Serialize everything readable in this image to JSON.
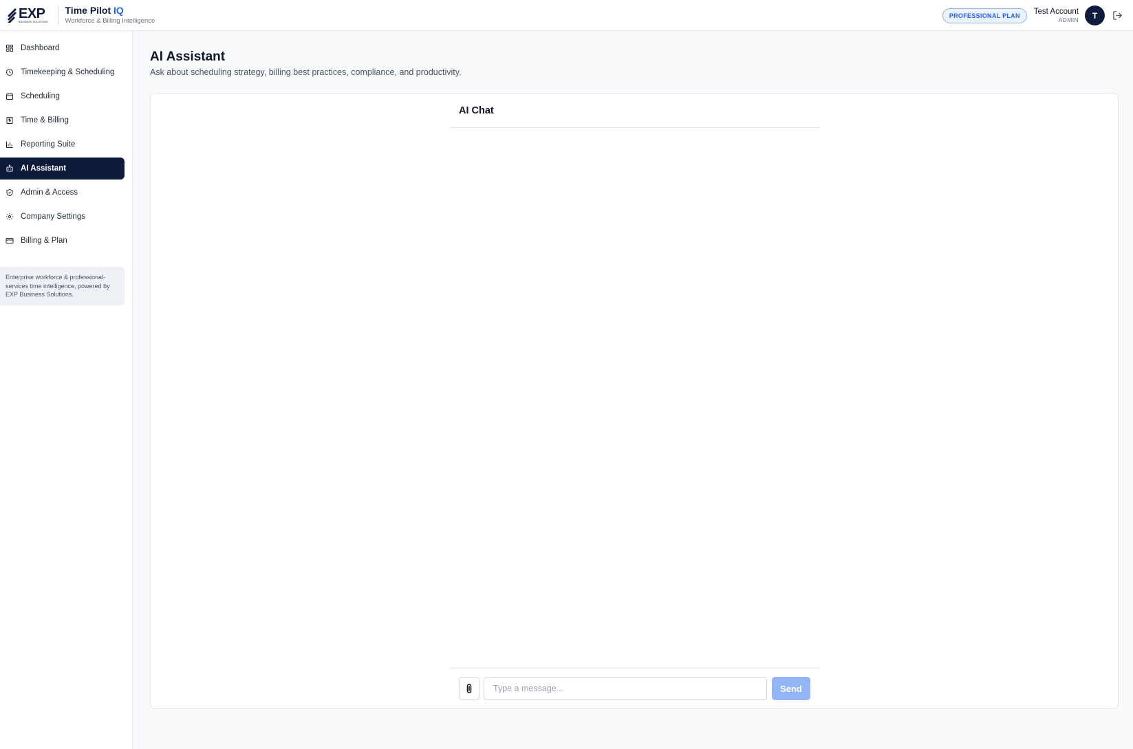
{
  "header": {
    "logo_text": "EXP",
    "logo_subtext": "BUSINESS SOLUTIONS",
    "brand_title": "Time Pilot",
    "brand_title_accent": "IQ",
    "brand_subtitle": "Workforce & Billing Intelligence",
    "plan_badge": "PROFESSIONAL PLAN",
    "account_name": "Test Account",
    "account_role": "ADMIN",
    "avatar_initial": "T",
    "logout_icon": "logout-icon"
  },
  "sidebar": {
    "items": [
      {
        "label": "Dashboard",
        "icon": "grid-icon",
        "active": false
      },
      {
        "label": "Timekeeping & Scheduling",
        "icon": "clock-icon",
        "active": false
      },
      {
        "label": "Scheduling",
        "icon": "calendar-icon",
        "active": false
      },
      {
        "label": "Time & Billing",
        "icon": "receipt-icon",
        "active": false
      },
      {
        "label": "Reporting Suite",
        "icon": "bar-chart-icon",
        "active": false
      },
      {
        "label": "AI Assistant",
        "icon": "bot-icon",
        "active": true
      },
      {
        "label": "Admin & Access",
        "icon": "shield-icon",
        "active": false
      },
      {
        "label": "Company Settings",
        "icon": "gear-icon",
        "active": false
      },
      {
        "label": "Billing & Plan",
        "icon": "credit-card-icon",
        "active": false
      }
    ],
    "note": "Enterprise workforce & professional-services time intelligence, powered by EXP Business Solutions."
  },
  "main": {
    "title": "AI Assistant",
    "subtitle": "Ask about scheduling strategy, billing best practices, compliance, and productivity.",
    "chat": {
      "title": "AI Chat",
      "input_value": "",
      "input_placeholder": "Type a message...",
      "send_label": "Send",
      "attach_icon": "paperclip-icon"
    }
  },
  "colors": {
    "navy": "#0f1b3d",
    "accent_blue": "#2563eb",
    "send_disabled": "#93b4f5",
    "badge_bg": "#eaf2ff"
  }
}
